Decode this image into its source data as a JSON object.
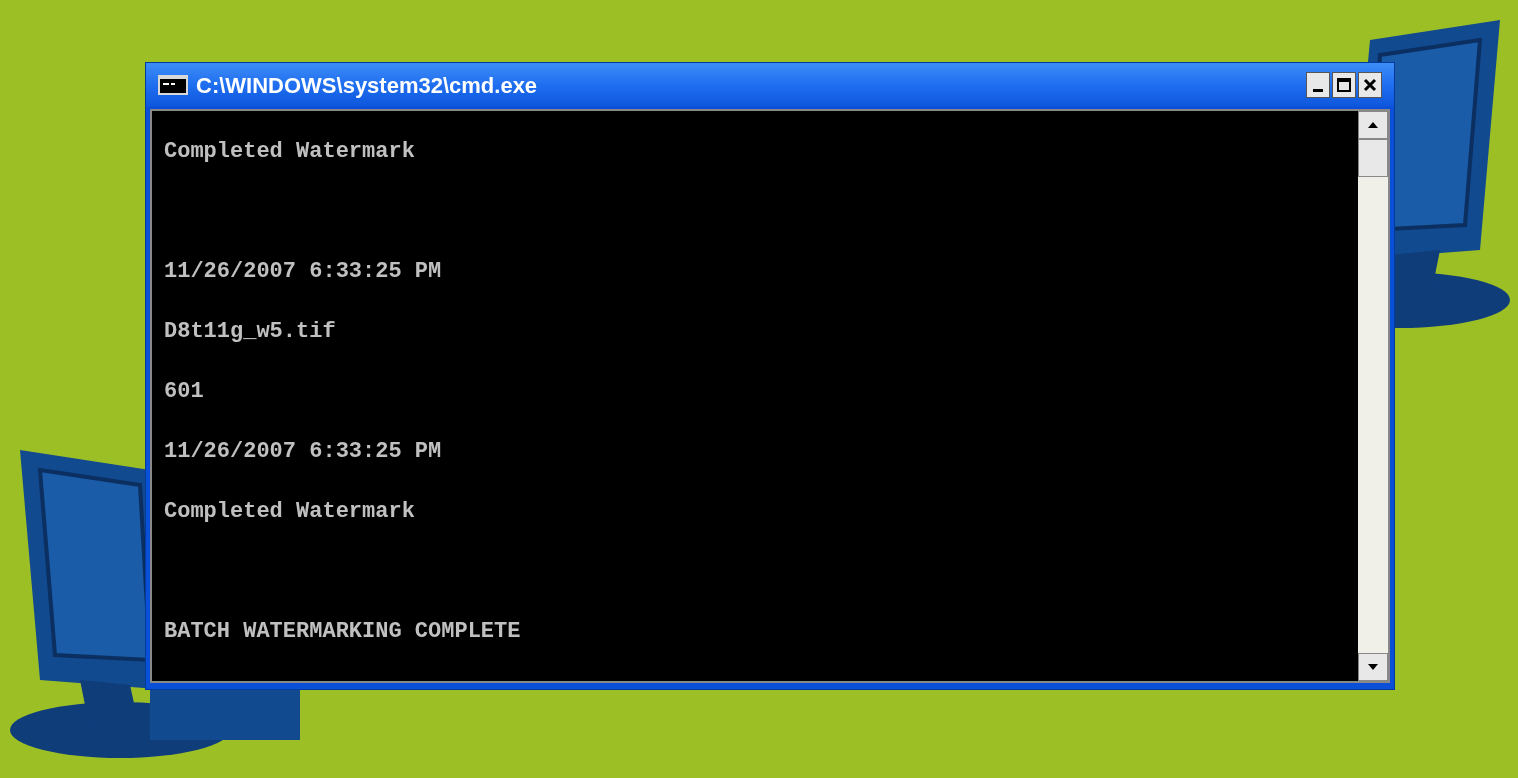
{
  "window": {
    "title": "C:\\WINDOWS\\system32\\cmd.exe"
  },
  "console": {
    "lines": [
      {
        "kind": "text",
        "text": "Completed Watermark"
      },
      {
        "kind": "blank"
      },
      {
        "kind": "text",
        "text": "11/26/2007 6:33:25 PM"
      },
      {
        "kind": "text",
        "text": "D8t11g_w5.tif"
      },
      {
        "kind": "text",
        "text": "601"
      },
      {
        "kind": "text",
        "text": "11/26/2007 6:33:25 PM"
      },
      {
        "kind": "text",
        "text": "Completed Watermark"
      },
      {
        "kind": "blank"
      },
      {
        "kind": "text",
        "text": "BATCH WATERMARKING COMPLETE"
      }
    ]
  }
}
